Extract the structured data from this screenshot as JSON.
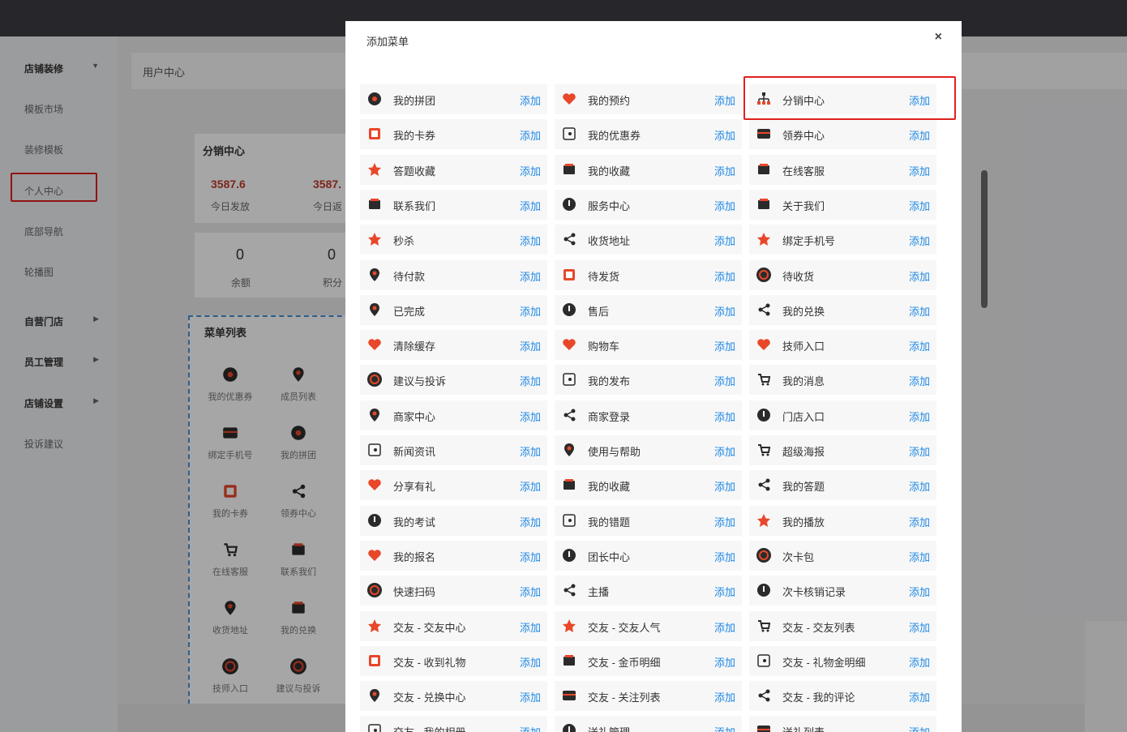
{
  "breadcrumb": "用户中心",
  "sidebar": [
    {
      "label": "店铺装修",
      "group": true,
      "arrow": "▼"
    },
    {
      "label": "模板市场"
    },
    {
      "label": "装修模板"
    },
    {
      "label": "个人中心",
      "selected": true
    },
    {
      "label": "底部导航"
    },
    {
      "label": "轮播图"
    },
    {
      "label": "自营门店",
      "group": true,
      "arrow": "▶"
    },
    {
      "label": "员工管理",
      "group": true,
      "arrow": "▶"
    },
    {
      "label": "店铺设置",
      "group": true,
      "arrow": "▶"
    },
    {
      "label": "投诉建议"
    }
  ],
  "preview": {
    "distribution": {
      "title": "分销中心",
      "stats": [
        {
          "value": "3587.6",
          "label": "今日发放"
        },
        {
          "value": "3587.",
          "label": "今日返"
        }
      ]
    },
    "wallet": [
      {
        "value": "0",
        "label": "余额"
      },
      {
        "value": "0",
        "label": "积分"
      }
    ],
    "menu_list": {
      "title": "菜单列表",
      "tiles": [
        "我的优惠券",
        "成员列表",
        "绑定手机号",
        "我的拼团",
        "我的卡券",
        "领券中心",
        "在线客服",
        "联系我们",
        "收货地址",
        "我的兑换",
        "技师入口",
        "建议与投诉"
      ]
    }
  },
  "modal": {
    "title": "添加菜单",
    "close": "×",
    "add_label": "添加",
    "items": [
      [
        "我的拼团",
        "我的预约",
        "分销中心"
      ],
      [
        "我的卡券",
        "我的优惠券",
        "领券中心"
      ],
      [
        "答题收藏",
        "我的收藏",
        "在线客服"
      ],
      [
        "联系我们",
        "服务中心",
        "关于我们"
      ],
      [
        "秒杀",
        "收货地址",
        "绑定手机号"
      ],
      [
        "待付款",
        "待发货",
        "待收货"
      ],
      [
        "已完成",
        "售后",
        "我的兑换"
      ],
      [
        "清除缓存",
        "购物车",
        "技师入口"
      ],
      [
        "建议与投诉",
        "我的发布",
        "我的消息"
      ],
      [
        "商家中心",
        "商家登录",
        "门店入口"
      ],
      [
        "新闻资讯",
        "使用与帮助",
        "超级海报"
      ],
      [
        "分享有礼",
        "我的收藏",
        "我的答题"
      ],
      [
        "我的考试",
        "我的错题",
        "我的播放"
      ],
      [
        "我的报名",
        "团长中心",
        "次卡包"
      ],
      [
        "快速扫码",
        "主播",
        "次卡核销记录"
      ],
      [
        "交友 - 交友中心",
        "交友 - 交友人气",
        "交友 - 交友列表"
      ],
      [
        "交友 - 收到礼物",
        "交友 - 金币明细",
        "交友 - 礼物金明细"
      ],
      [
        "交友 - 兑换中心",
        "交友 - 关注列表",
        "交友 - 我的评论"
      ],
      [
        "交友 - 我的相册",
        "送礼管理",
        "送礼列表"
      ]
    ]
  },
  "colors": {
    "accent": "#1e88e5",
    "icon_red": "#e8472a",
    "icon_dark": "#2b2b2b",
    "highlight": "#e02020"
  }
}
